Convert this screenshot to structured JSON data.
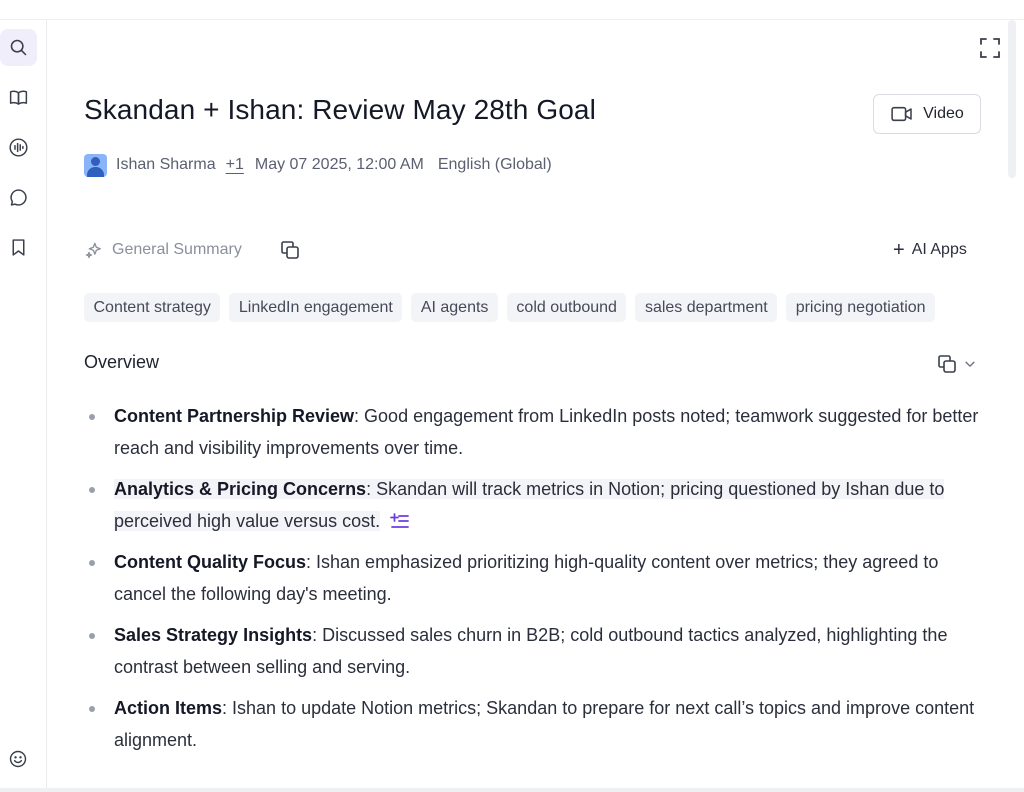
{
  "rail": {
    "items": [
      {
        "icon": "search-icon",
        "active": true
      },
      {
        "icon": "book-open-icon",
        "active": false
      },
      {
        "icon": "audio-wave-icon",
        "active": false
      },
      {
        "icon": "chat-bubble-icon",
        "active": false
      },
      {
        "icon": "bookmark-icon",
        "active": false
      }
    ],
    "bottom_icon": "smile-icon"
  },
  "meeting": {
    "title": "Skandan + Ishan: Review May 28th Goal",
    "video_label": "Video",
    "host": "Ishan Sharma",
    "extra_participants": "+1",
    "datetime": "May 07 2025, 12:00 AM",
    "language": "English (Global)"
  },
  "summary": {
    "label": "General Summary",
    "ai_apps_label": "AI Apps"
  },
  "tags": [
    "Content strategy",
    "LinkedIn engagement",
    "AI agents",
    "cold outbound",
    "sales department",
    "pricing negotiation"
  ],
  "overview": {
    "heading": "Overview",
    "items": [
      {
        "key": "Content Partnership Review",
        "text": ": Good engagement from LinkedIn posts noted; teamwork suggested for better reach and visibility improvements over time."
      },
      {
        "key": "Analytics & Pricing Concerns",
        "text": ": Skandan will track metrics in Notion; pricing questioned by Ishan due to perceived high value versus cost."
      },
      {
        "key": "Content Quality Focus",
        "text": ": Ishan emphasized prioritizing high-quality content over metrics; they agreed to cancel the following day's meeting."
      },
      {
        "key": "Sales Strategy Insights",
        "text": ": Discussed sales churn in B2B; cold outbound tactics analyzed, highlighting the contrast between selling and serving."
      },
      {
        "key": "Action Items",
        "text": ": Ishan to update Notion metrics; Skandan to prepare for next call’s topics and improve content alignment."
      }
    ]
  },
  "colors": {
    "accent": "#6d3fe0",
    "active_rail_bg": "#f1eefc",
    "tag_bg": "#f3f4f7"
  }
}
